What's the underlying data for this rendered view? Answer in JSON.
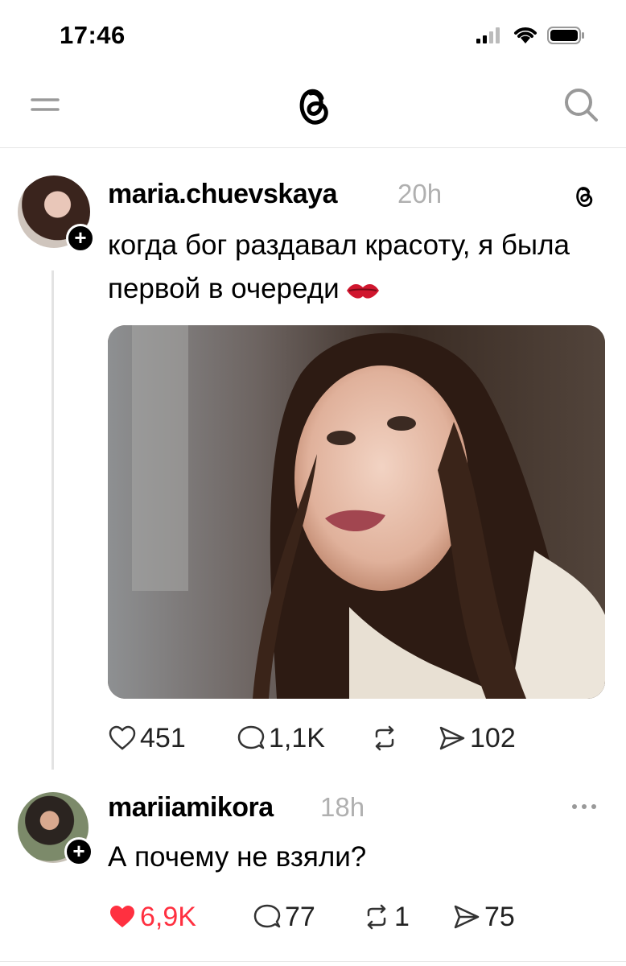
{
  "status_bar": {
    "time": "17:46"
  },
  "post": {
    "username": "maria.chuevskaya",
    "timestamp": "20h",
    "text": "когда бог раздавал красоту, я была первой в очереди",
    "actions": {
      "likes": "451",
      "replies": "1,1K",
      "reposts": "",
      "shares": "102"
    }
  },
  "reply": {
    "username": "mariiamikora",
    "timestamp": "18h",
    "text": "А почему не взяли?",
    "actions": {
      "likes": "6,9K",
      "replies": "77",
      "reposts": "1",
      "shares": "75"
    },
    "liked": true
  },
  "colors": {
    "like_active": "#ff3040",
    "muted": "#b0b0b0",
    "divider": "#e6e6e6"
  }
}
